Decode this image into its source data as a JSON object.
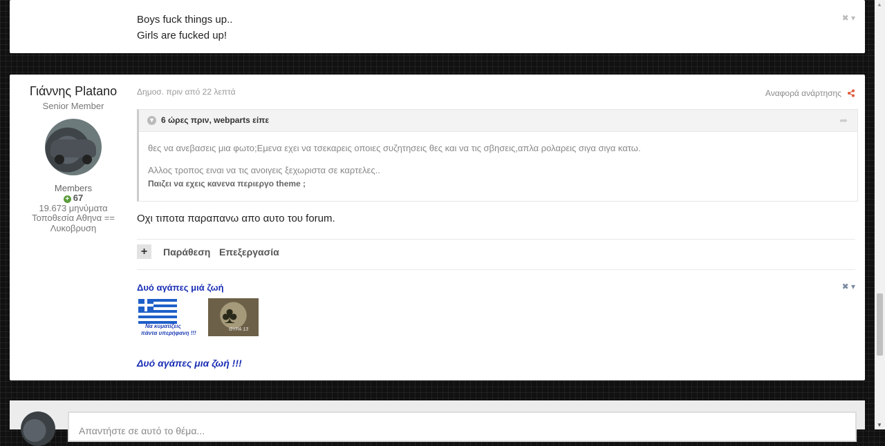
{
  "previous_post": {
    "line1": "Boys fuck things up..",
    "line2": "Girls are fucked up!",
    "controls": "✖ ▾"
  },
  "author": {
    "name": "Γιάννης Platano",
    "title": "Senior Member",
    "group": "Members",
    "reputation": "67",
    "posts": "19.673 μηνύματα",
    "location": "Τοποθεσία Αθηνα == Λυκοβρυση"
  },
  "post": {
    "date": "Δημοσ. πριν από 22 λεπτά",
    "report_label": "Αναφορά ανάρτησης",
    "body": "Οχι τιποτα παραπανω απο αυτο του forum.",
    "quote": {
      "citation": "6 ώρες πριν, webparts είπε",
      "line1": "θες να ανεβασεις μια φωτο;Εμενα εχει να τσεκαρεις οποιες συζητησεις θες και να τις σβησεις,απλα ρολαρεις σιγα σιγα κατω.",
      "line2": "Αλλος τροπος ειναι να τις ανοιγεις ξεχωριστα σε καρτελες..",
      "line3": "Παιζει να εχεις κανενα περιεργο theme ;"
    },
    "actions": {
      "plus": "+",
      "quote": "Παράθεση",
      "edit": "Επεξεργασία"
    }
  },
  "signature": {
    "title": "Δυό αγάπες μιά ζωή",
    "controls": "✖ ▾",
    "flag_text1": "Να κυματίζεις",
    "flag_text2": "πάντα υπερήφανη !!!",
    "clover_text": "ΘΥΡΑ 13",
    "footer": "Δυό αγάπες μια ζωή !!!"
  },
  "reply": {
    "placeholder": "Απαντήστε σε αυτό το θέμα..."
  },
  "icons": [
    "close-icon",
    "chevron-down-icon",
    "share-icon",
    "reputation-plus-icon",
    "quote-toggle-icon",
    "quote-share-icon",
    "scroll-up-icon",
    "scroll-down-icon"
  ],
  "colors": {
    "accent_share": "#e05a3a",
    "signature_blue": "#1a2fb5",
    "reputation_green": "#5a9c3a"
  }
}
